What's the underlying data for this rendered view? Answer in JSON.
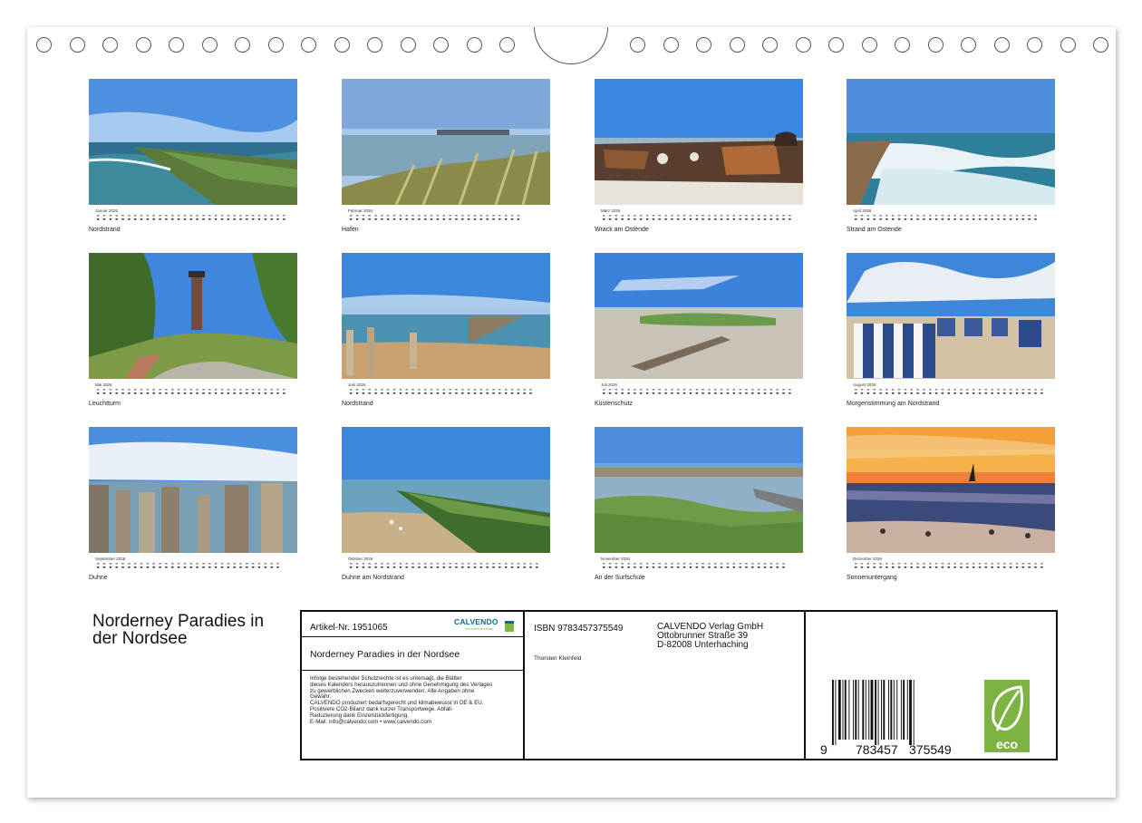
{
  "months": [
    {
      "month": "Januar 2026",
      "caption": "Nordstrand",
      "photo": "Groyne with rocks at Nordstrand"
    },
    {
      "month": "Februar 2026",
      "caption": "Hafen",
      "photo": "Dune grass by the harbour"
    },
    {
      "month": "März 2026",
      "caption": "Wrack am Ostende",
      "photo": "Rusty shipwreck on beach"
    },
    {
      "month": "April 2026",
      "caption": "Strand am Ostende",
      "photo": "Waves on sand beach"
    },
    {
      "month": "Mai 2026",
      "caption": "Leuchtturm",
      "photo": "Lighthouse with trees"
    },
    {
      "month": "Juni 2026",
      "caption": "Nordstrand",
      "photo": "Wooden groynes at low tide"
    },
    {
      "month": "Juli 2026",
      "caption": "Küstenschutz",
      "photo": "Driftwood on wide beach"
    },
    {
      "month": "August 2026",
      "caption": "Morgenstimmung am Nordstrand",
      "photo": "Beach chairs"
    },
    {
      "month": "September 2026",
      "caption": "Duhne",
      "photo": "Weathered wooden posts"
    },
    {
      "month": "Oktober 2026",
      "caption": "Duhne am Nordstrand",
      "photo": "Mossy groyne and gulls"
    },
    {
      "month": "November 2026",
      "caption": "An der Surfschule",
      "photo": "Salt marsh and pier"
    },
    {
      "month": "Dezember 2026",
      "caption": "Sonnenuntergang",
      "photo": "Sunset with birds"
    }
  ],
  "title": "Norderney Paradies in der Nordsee",
  "info": {
    "artikel": "Artikel-Nr. 1951065",
    "logo_name": "CALVENDO",
    "logo_sub": "Ihre Kalenderverlag",
    "subtitle": "Norderney Paradies in der Nordsee",
    "legal": [
      "Infolge bestehender Schutzrechte ist es untersagt, die Blätter",
      "dieses Kalenders herauszutrennen und ohne Genehmigung des Verlages",
      "zu gewerblichen Zwecken weiterzuverwenden. Alle Angaben ohne",
      "Gewähr.",
      "CALVENDO produziert bedarfsgerecht und klimabewusst in DE & EU.",
      "Positivere CO2-Bilanz dank kurzer Transportwege. Abfall-",
      "Reduzierung dank Einzelstückfertigung.",
      "E-Mail: info@calvendo.com • www.calvendo.com"
    ],
    "isbn": "ISBN 9783457375549",
    "publisher": [
      "CALVENDO Verlag GmbH",
      "Ottobrunner Straße 39",
      "D-82008 Unterhaching"
    ],
    "author": "Thorsten Kleinfeld",
    "barcode_digits": [
      "9",
      "783457",
      "375549"
    ],
    "eco_label": "eco"
  }
}
